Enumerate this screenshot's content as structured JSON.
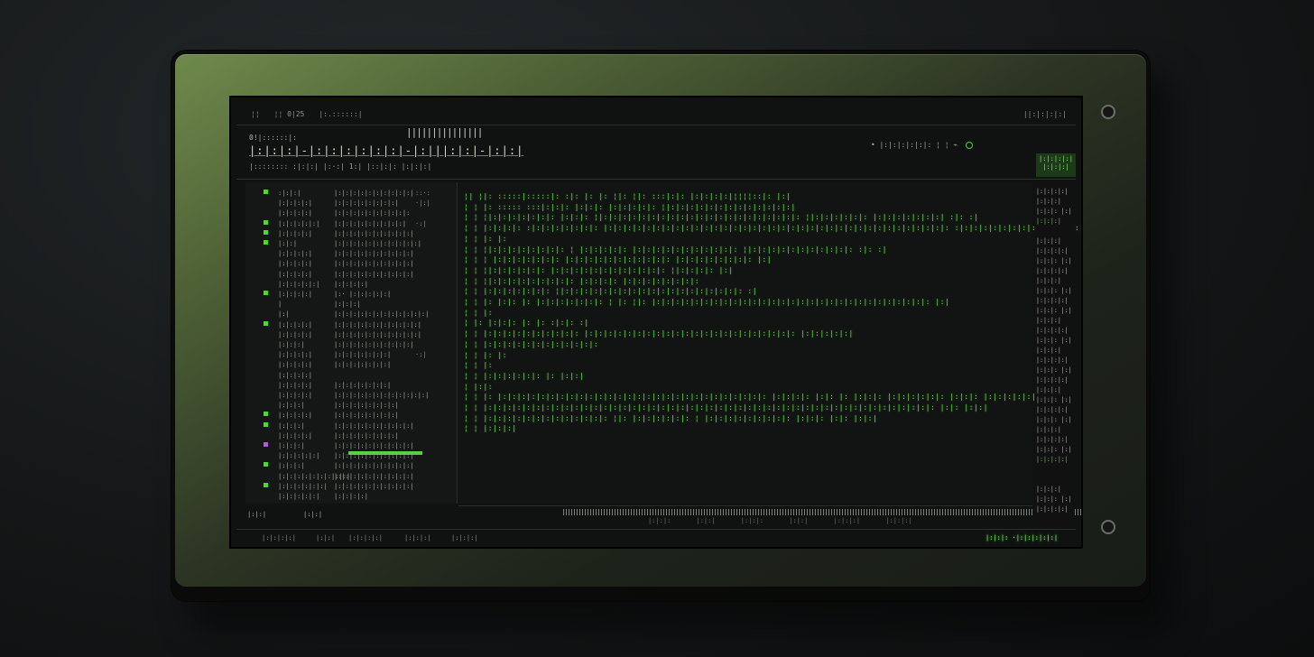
{
  "titlebar": {
    "items": [
      "¦¦",
      "¦¦ 0|25",
      "|:.::::::|"
    ],
    "right": "||:|:|:|:|"
  },
  "header": {
    "crumb": "0!|::::::|:",
    "title": "|:|:|:|-|:|:|:|:|:|:|-|:|||:|:|-|:|:|",
    "glyph_bar": "|||||||||||||||",
    "status_line": "|:::::::: :|:|:| |:·:| 1:| |::|:|: |:|:|:|",
    "right_text": "• |:|:|:|:|:|: ¦ ¦ ⌁",
    "status_box": "|:|:|:|:| |:|:|:|"
  },
  "sidebar": {
    "rows": [
      {
        "mark": "green",
        "name": ":|:|:|",
        "val": "|:|:|:|:|:|:|:|:|:|:|",
        "num": "::·:"
      },
      {
        "mark": "",
        "name": "|:|:|:|:|",
        "val": "|:|:|:|:|:|:|:|:|",
        "num": "·|:|"
      },
      {
        "mark": "",
        "name": "|:|:|:|:|",
        "val": "|:|:|:|:|:|:|:|:|:|:",
        "num": ""
      },
      {
        "mark": "green",
        "name": "|:|:|:|:|:|",
        "val": "|:|:|:|:|:|:|:|:|:|",
        "num": "·:|"
      },
      {
        "mark": "green",
        "name": "|:|:|:|:|",
        "val": "|:|:|:|:|:|:|:|:|:|:|",
        "num": ""
      },
      {
        "mark": "green",
        "name": "|:|:|",
        "val": "|:|:|:|:|:|:|:|:|:|:|:|",
        "num": ""
      },
      {
        "mark": "",
        "name": "|:|:|:|:|",
        "val": "|:|:|:|:|:|:|:|:|:|:|",
        "num": ""
      },
      {
        "mark": "",
        "name": "|:|:|:|:|",
        "val": "|:|:|:|:|:|:|:|:|:|:|",
        "num": ""
      },
      {
        "mark": "",
        "name": "|:|:|:|:|",
        "val": "|:|:|:|:|:|:|:|:|:|:|",
        "num": ""
      },
      {
        "mark": "",
        "name": "|:|:|:|:|:|",
        "val": "|:|:|:|:|",
        "num": ""
      },
      {
        "mark": "green",
        "name": "|:|:|:|:|",
        "val": "|:· |:|:|:|:|:|",
        "num": ""
      },
      {
        "mark": "",
        "name": "|",
        "val": "|:|:|:|",
        "num": ""
      },
      {
        "mark": "",
        "name": "|:|",
        "val": "|:|:|:|:|:|:|:|:|:|:|:|:|",
        "num": ""
      },
      {
        "mark": "green",
        "name": "|:|:|:|:|",
        "val": "|:|:|:|:|:|:|:|:|:|:|:|",
        "num": ""
      },
      {
        "mark": "",
        "name": "|:|:|:|:|",
        "val": "|:|:|:|:|:|:|:|:|:|:|:|",
        "num": ""
      },
      {
        "mark": "",
        "name": "|:|:|:|",
        "val": "|:|:|:|:|:|:|:|:|:|:|",
        "num": ""
      },
      {
        "mark": "",
        "name": "|:|:|:|:|",
        "val": "|:|:|:|:|:|:|:|",
        "num": "·:|"
      },
      {
        "mark": "",
        "name": "|:|:|:|:|",
        "val": "|:|:|:|:|:|:|:|",
        "num": ""
      },
      {
        "mark": "",
        "name": "|:|:|:|:|",
        "val": "",
        "num": ""
      },
      {
        "mark": "",
        "name": "|:|:|:|:|",
        "val": "|:|:|:|:|:|:|:|",
        "num": ""
      },
      {
        "mark": "",
        "name": "|:|:|:|:|",
        "val": "|:|:|:|:|:|:|:|:|:|:|:|:|",
        "num": ""
      },
      {
        "mark": "",
        "name": "|:|:|:|",
        "val": "|:|:|:|:|:|:|:|:|",
        "num": ""
      },
      {
        "mark": "green",
        "name": "|:|:|:|:|",
        "val": "|:|:|:|:|:|:|:|:|",
        "num": ""
      },
      {
        "mark": "green",
        "name": "|:|:|:|",
        "val": "|:|:|:|:|:|:|:|:|:|:|",
        "num": ""
      },
      {
        "mark": "",
        "name": "|:|:|:|:|",
        "val": "|:|:|:|:|:|:|:|:|",
        "num": ""
      },
      {
        "mark": "purple",
        "name": "|:|:|:|",
        "val": "|:|:|:|:|:|:|:|:|:|:|",
        "num": ""
      },
      {
        "mark": "",
        "name": "|:|:|:|:|:|",
        "val": "|:|:|:|:|:|:|:|:|:|:|",
        "num": ""
      },
      {
        "mark": "green",
        "name": "|:|:|:|",
        "val": "|:|:|:|:|:|:|:|:|:|:|",
        "num": ""
      },
      {
        "mark": "",
        "name": "|:|:|:|:|:|:|:|:|:|",
        "val": "|:|:|:|:|:|:|:|:|:|:|",
        "num": ""
      },
      {
        "mark": "green",
        "name": "|:|:|:|:|:|:|",
        "val": "|:|:|:|:|:|:|:|:|:|:|",
        "num": ""
      },
      {
        "mark": "",
        "name": "|:|:|:|:|:|",
        "val": "|:|:|:|:|",
        "num": ""
      }
    ]
  },
  "editor": {
    "lines": [
      "¦| ¦|: :::::|:::::|: :|: |: |: ¦|: ¦|: :::|:|: |:|:|:|:|¦¦¦¦::|: |:|",
      "¦ ¦ |: ::::: :::|:|:|: |:|:|: |:|:|:|:|: ¦|:|:|:|:|:|:|:|:|:|:|:|:|:|",
      "¦ ¦ ¦|:|:|:|:|:|:|: |:|:|: ¦|:|:|:|:|:|:|:|:|:|:|:|:|:|:|:|:|:|:|:|:|: ¦|:|:|:|:|:|: |:|:|:|:|:|:|:| :|: :|",
      "¦ ¦ |:|:|:|: :|:|:|:|:|:|:|: |:|:|:|:|:|:|:|:|:|:|:|:|:|:|:|:|:|:|:|:|:|:|:|:|:|:|:|:|:|:|:|:|:|:|:|: :|:|:|:|:|:|:|:|:|:|:|: |:|",
      "¦ ¦ |: |:",
      "¦ ¦ ¦|:|:|:|:|:|:|:|: ¦ |:|:|:|:|: |:|:|:|:|:|:|:|:|:|:|: ¦|:|:|:|:|:|:|:|:|:|:|: :|: :|",
      "¦ ¦ ¦ |:|:|:|:|:|:|: |:|:|:|:|:|:|:|:|:|:|: |:|:|:|:|:|:|:|: |:|",
      "¦ ¦ ¦|:|:|:|:|:|: |:|:|:|:|:|:|:|:|:|:|:|: ¦|:|:|:|: |:|",
      "¦ ¦ ¦|:|:|:|:|:|:|:|:|: |:|:|:|: |:|:|:|:|:|:|:|:",
      "¦ ¦ |:|:|:|:|:|:|: ¦|:|:|:|:|:|:|:|:|:|:|:|:|:|:|:|:|:|:|: :|",
      "¦ ¦ |: |:|: |: |:|:|:|:|:|:|: ¦ |: ¦|: |:|:|:|:|:|:|:|:|:|:|:|:|:|:|:|:|:|:|:|:|:|:|:|:|:|:|:|:|: |:|",
      "¦ ¦ |:",
      "  ¦ |:  |:|:|:    |:    |: :|:|: :|",
      "¦ ¦ |:|:|:|:|:|:|:|:|:|: |:|:|:|:|:|:|:|:|:|:|:|:|:|:|:|:|:|:|:|:|:|: |:|:|:|:|:|",
      "¦ ¦ |:|:|:|:|:|:|:|:|:|:|:|:",
      "¦ ¦ |: |:",
      "¦ ¦ |:",
      "¦ ¦ |:|:|:|:|:|: |: |:|:|",
      "  ¦ |:|:",
      "¦ ¦ |: |:|:|:|:|:|:|:|:|:|:|:|:|:|:|:|:|:|:|:|:|:|:|:|:|:|:|:|: |:|:|:|: |:|: |: |:|:|: |:|:|:|:|:|: |:|:|: |:|:|:|:|:|:|:|",
      "¦ ¦ |:|:|:|:|:|:|:|:|:|:|:|:|:|:|:|:|:|:|:|:|:|:|:|:|:|:|:|:|:|:|:|:|:|:|:|:|:|:|:|:|:|:|:|:|:|:|:        |:|: |:|:|",
      "¦ ¦ |:|:|:|:|:|:|:|:|:|:|:|:|: ¦|: |:|:|:|:|:|: ¦ |:|:|:|:|:|:|:|:|: |:|:|: |:|: |:|:|",
      "¦ ¦ |:|:|:|"
    ]
  },
  "ruler": {
    "labels": "|:|:|: |:|:|   |:|:|: |:|:|   |:|:|:|   |:|:|:|"
  },
  "right_panel": {
    "items": [
      {
        "t": "|:|:|:|:|",
        "g": false
      },
      {
        "t": "|:|:|:|",
        "g": false
      },
      {
        "t": "|:|:|: |:|",
        "g": false
      },
      {
        "t": "|:|:|:|",
        "g": true
      },
      {
        "t": "",
        "g": false
      },
      {
        "t": "|:|:|:|",
        "g": false
      },
      {
        "t": "|:|:|:|:|",
        "g": false
      },
      {
        "t": "|:|:|: |:|",
        "g": false
      },
      {
        "t": "|:|:|:|:|",
        "g": false
      },
      {
        "t": "|:|:|:|",
        "g": false
      },
      {
        "t": "|:|:|: |:|",
        "g": false
      },
      {
        "t": "|:|:|:|:|",
        "g": false
      },
      {
        "t": "|:|:|: |:|",
        "g": false
      },
      {
        "t": "|:|:|:|",
        "g": false
      },
      {
        "t": "|:|:|:|:|",
        "g": false
      },
      {
        "t": "|:|:|: |:|",
        "g": false
      },
      {
        "t": "|:|:|:|",
        "g": false
      },
      {
        "t": "|:|:|:|:|",
        "g": false
      },
      {
        "t": "|:|:|: |:|",
        "g": false
      },
      {
        "t": "|:|:|:|:|",
        "g": false
      },
      {
        "t": "|:|:|:|",
        "g": false
      },
      {
        "t": "|:|:|: |:|",
        "g": false
      },
      {
        "t": "|:|:|:|:|",
        "g": false
      },
      {
        "t": "|:|:|: |:|",
        "g": false
      },
      {
        "t": "|:|:|:|",
        "g": false
      },
      {
        "t": "|:|:|:|:|",
        "g": false
      },
      {
        "t": "|:|:|: |:|",
        "g": false
      },
      {
        "t": "|:|:|:|:|",
        "g": true
      },
      {
        "t": "",
        "g": false
      },
      {
        "t": "",
        "g": false
      },
      {
        "t": "|:|:|:|",
        "g": false
      },
      {
        "t": "|:|:|: |:|",
        "g": false
      },
      {
        "t": "|:|:|:|:|",
        "g": false
      }
    ]
  },
  "footer": {
    "left_a": "|:|:|",
    "left_b": "|:|:|",
    "items": [
      "|:|:|:|:|",
      "|:|:|",
      "|:|:|:|:|",
      "|:|:|:|",
      "|:|:|:|"
    ],
    "status": "|:|:|: ·|:|:|:|:|:|"
  },
  "colors": {
    "accent_green": "#5fd84a",
    "frame_olive": "#5f7a42",
    "screen_bg": "#101211"
  }
}
